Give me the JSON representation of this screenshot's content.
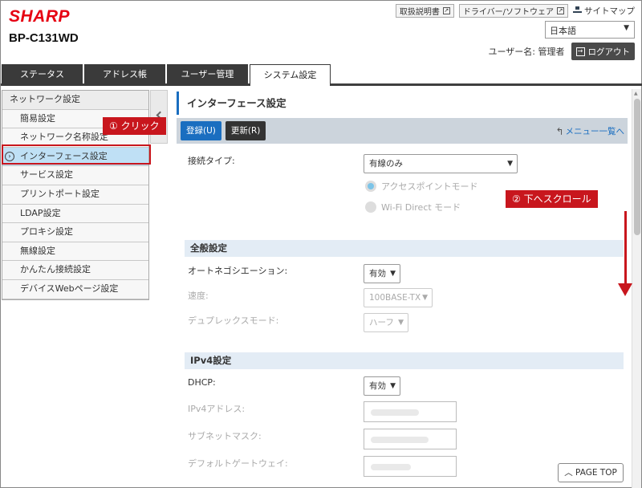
{
  "brand": {
    "logo": "SHARP",
    "model": "BP-C131WD"
  },
  "toplinks": {
    "manual": "取扱説明書",
    "driver": "ドライバー/ソフトウェア",
    "sitemap": "サイトマップ"
  },
  "language": {
    "selected": "日本語"
  },
  "user": {
    "label": "ユーザー名: 管理者",
    "logout": "ログアウト"
  },
  "tabs": [
    {
      "label": "ステータス"
    },
    {
      "label": "アドレス帳"
    },
    {
      "label": "ユーザー管理"
    },
    {
      "label": "システム設定"
    }
  ],
  "sidebar": {
    "items": [
      {
        "label": "ネットワーク設定"
      },
      {
        "label": "簡易設定"
      },
      {
        "label": "ネットワーク名称設定"
      },
      {
        "label": "インターフェース設定"
      },
      {
        "label": "サービス設定"
      },
      {
        "label": "プリントポート設定"
      },
      {
        "label": "LDAP設定"
      },
      {
        "label": "プロキシ設定"
      },
      {
        "label": "無線設定"
      },
      {
        "label": "かんたん接続設定"
      },
      {
        "label": "デバイスWebページ設定"
      }
    ]
  },
  "main": {
    "title": "インターフェース設定",
    "register": "登録(U)",
    "update": "更新(R)",
    "menu_link": "メニュー一覧へ",
    "connection_type_label": "接続タイプ:",
    "connection_type_value": "有線のみ",
    "radio_ap": "アクセスポイントモード",
    "radio_wifi_direct": "Wi-Fi Direct モード",
    "general_section": "全般設定",
    "autoneg_label": "オートネゴシエーション:",
    "autoneg_value": "有効",
    "speed_label": "速度:",
    "speed_value": "100BASE-TX",
    "duplex_label": "デュプレックスモード:",
    "duplex_value": "ハーフ",
    "ipv4_section": "IPv4設定",
    "dhcp_label": "DHCP:",
    "dhcp_value": "有効",
    "ipv4_address_label": "IPv4アドレス:",
    "subnet_label": "サブネットマスク:",
    "gateway_label": "デフォルトゲートウェイ:",
    "page_top": "PAGE TOP"
  },
  "annotations": {
    "step1": "① クリック",
    "step2": "② 下へスクロール",
    "color": "#c8161d"
  },
  "colors": {
    "brand": "#e60012",
    "accent": "#1a6ec0",
    "tab_dark": "#3a3a3a",
    "active_item": "#bfe0f5"
  }
}
